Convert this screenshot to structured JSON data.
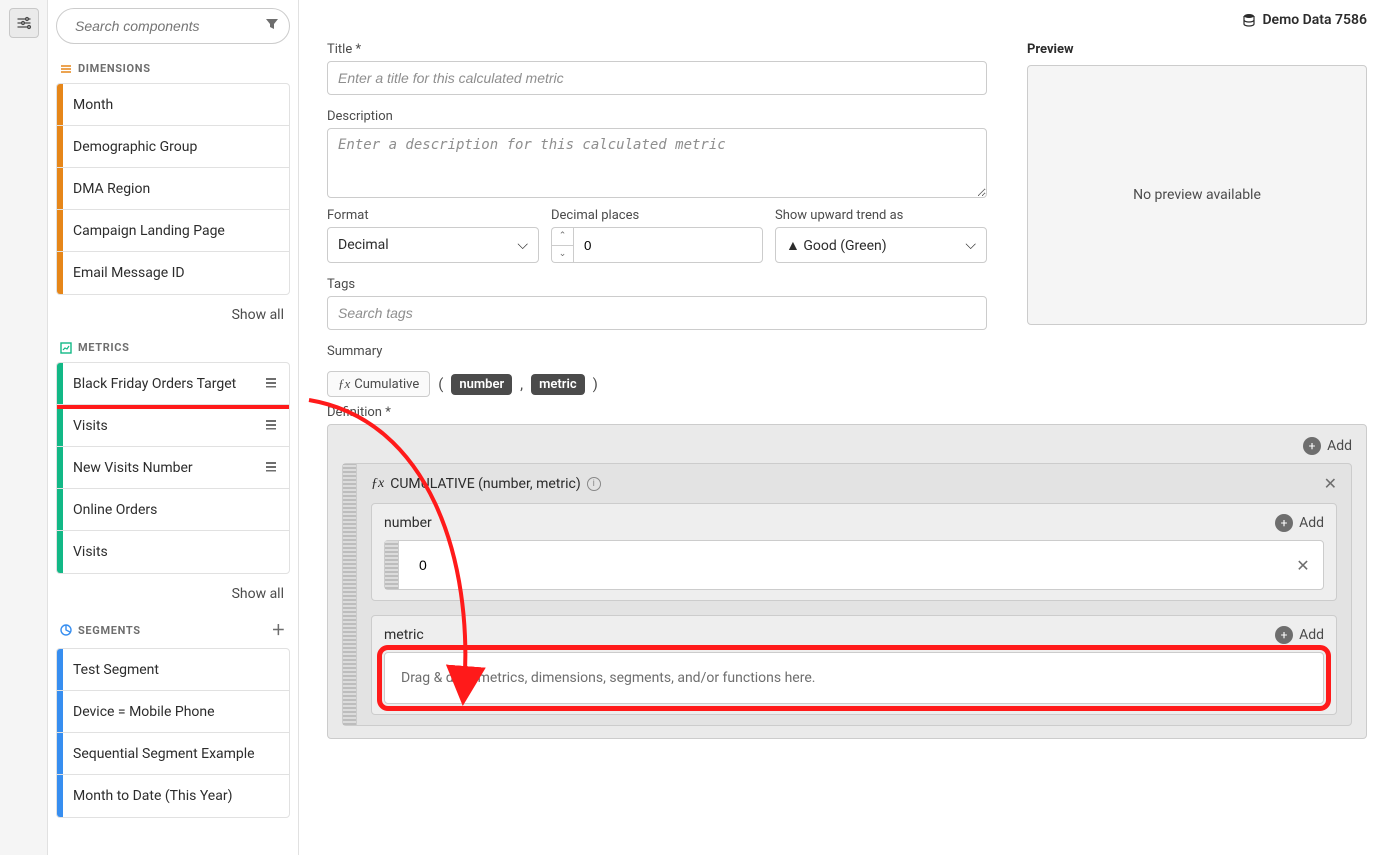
{
  "header": {
    "datasource": "Demo Data 7586"
  },
  "search": {
    "placeholder": "Search components"
  },
  "sections": {
    "dimensions": {
      "label": "DIMENSIONS",
      "items": [
        "Month",
        "Demographic Group",
        "DMA Region",
        "Campaign Landing Page",
        "Email Message ID"
      ]
    },
    "metrics": {
      "label": "METRICS",
      "items": [
        {
          "label": "Black Friday Orders Target",
          "hasIcon": true,
          "highlighted": true
        },
        {
          "label": "Visits",
          "hasIcon": true
        },
        {
          "label": "New Visits Number",
          "hasIcon": true
        },
        {
          "label": "Online Orders"
        },
        {
          "label": "Visits"
        }
      ]
    },
    "segments": {
      "label": "SEGMENTS",
      "items": [
        "Test Segment",
        "Device = Mobile Phone",
        "Sequential Segment Example",
        "Month to Date (This Year)"
      ]
    }
  },
  "showall": "Show all",
  "form": {
    "title_label": "Title",
    "title_placeholder": "Enter a title for this calculated metric",
    "desc_label": "Description",
    "desc_placeholder": "Enter a description for this calculated metric",
    "format_label": "Format",
    "format_value": "Decimal",
    "decimal_label": "Decimal places",
    "decimal_value": "0",
    "trend_label": "Show upward trend as",
    "trend_value": "▲ Good (Green)",
    "tags_label": "Tags",
    "tags_placeholder": "Search tags",
    "preview_label": "Preview",
    "preview_empty": "No preview available",
    "summary_label": "Summary",
    "definition_label": "Definition"
  },
  "summary": {
    "fn": "Cumulative",
    "arg1": "number",
    "arg2": "metric"
  },
  "definition": {
    "add": "Add",
    "fn_title": "CUMULATIVE (number, metric)",
    "slot_number": "number",
    "slot_number_value": "0",
    "slot_metric": "metric",
    "drop_hint": "Drag & drop metrics, dimensions, segments, and/or functions here."
  }
}
